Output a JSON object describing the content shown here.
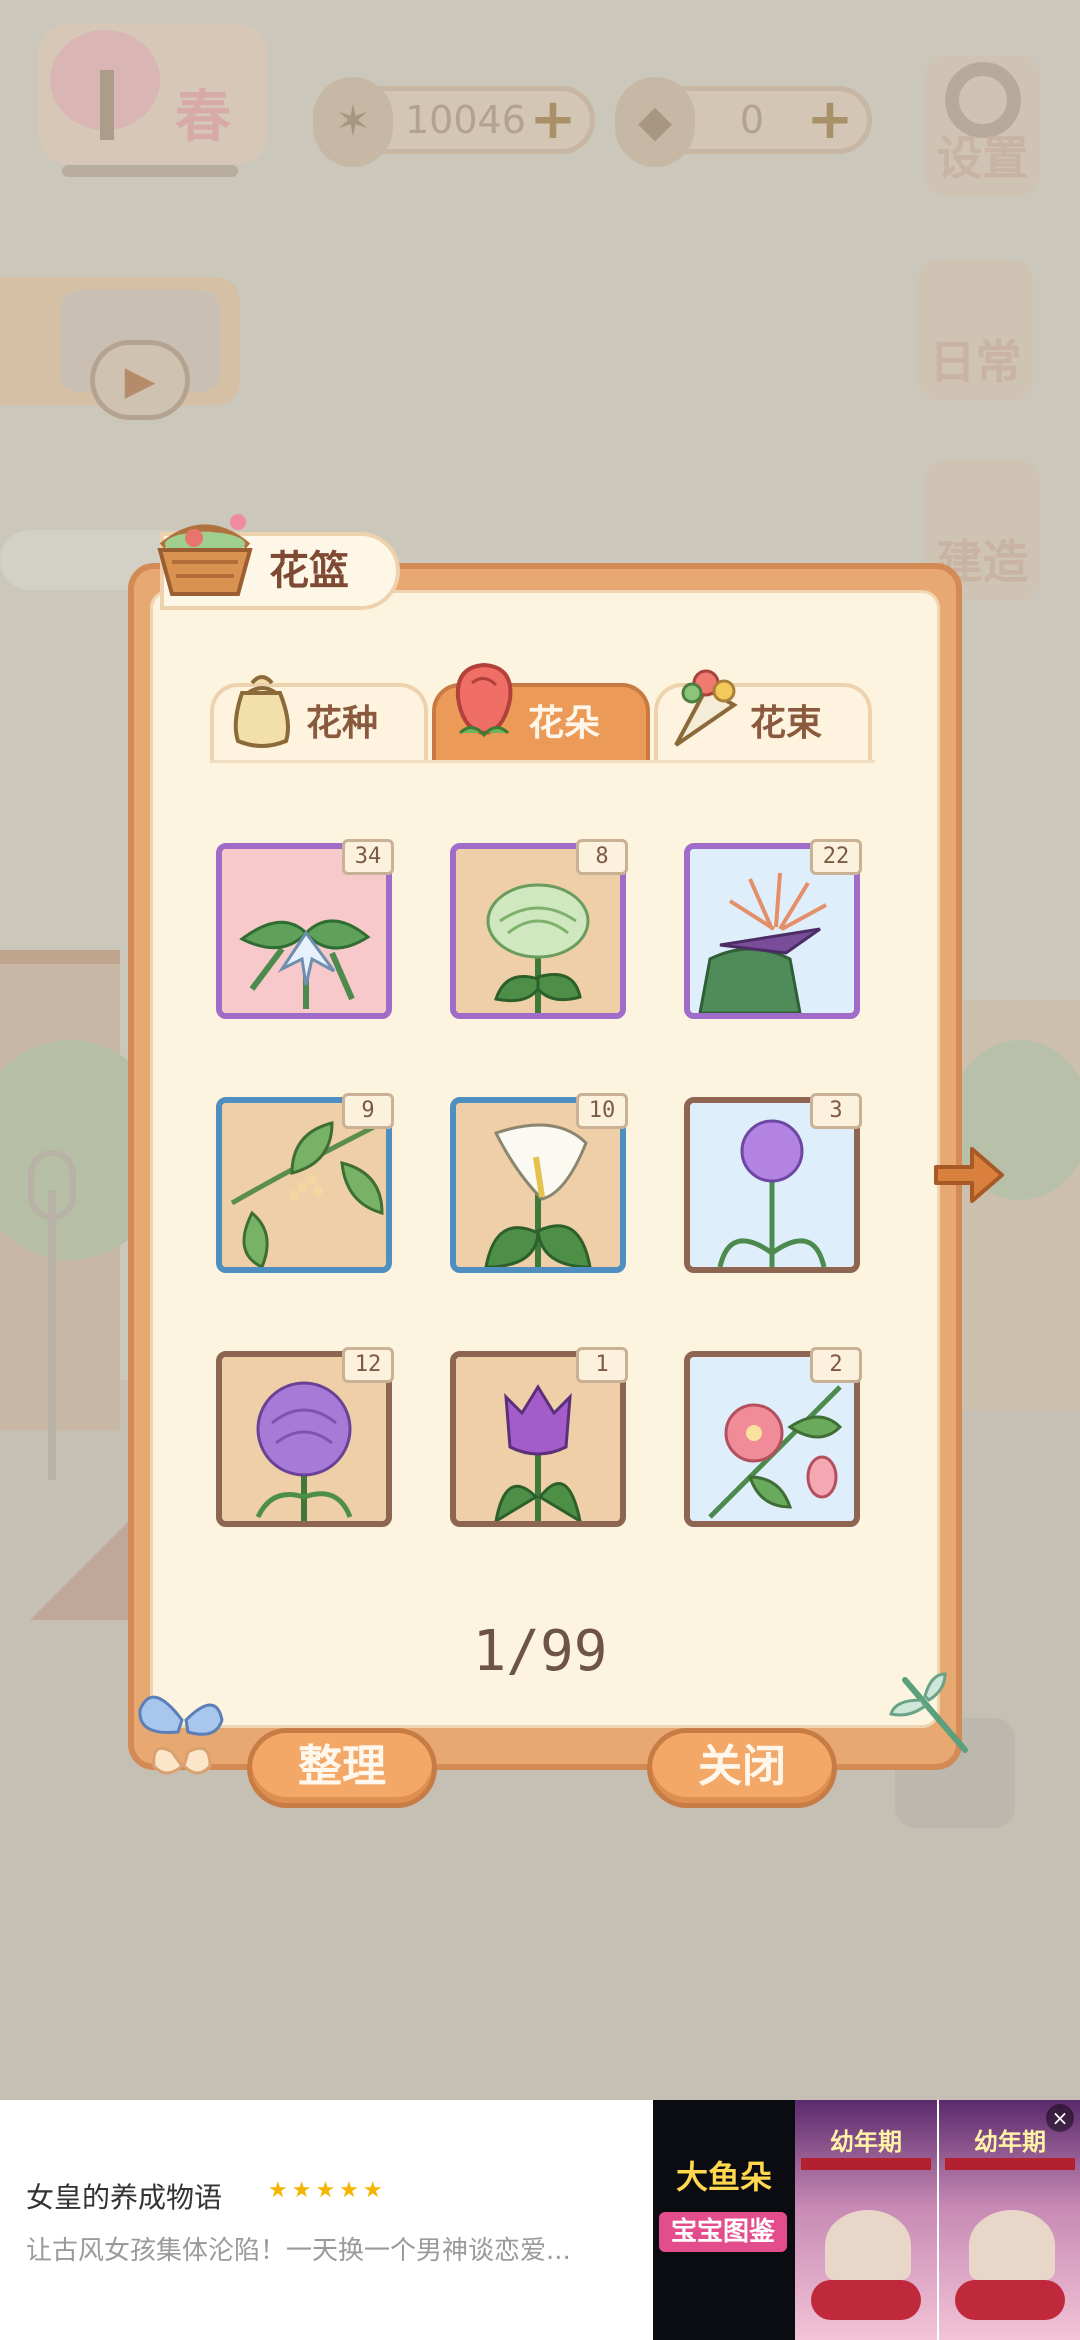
{
  "hud": {
    "season": "春",
    "fish_icon": "fish-bone-icon",
    "fish_count": "10046",
    "cheese_icon": "cheese-icon",
    "cheese_count": "0",
    "plus": "+",
    "settings_label": "设置",
    "daily_label": "日常",
    "build_label": "建造"
  },
  "panel": {
    "title": "花篮",
    "tabs": [
      {
        "label": "花种",
        "icon": "seed-bag-icon",
        "active": false
      },
      {
        "label": "花朵",
        "icon": "rose-icon",
        "active": true
      },
      {
        "label": "花束",
        "icon": "bouquet-icon",
        "active": false
      }
    ],
    "items": [
      {
        "count": "34",
        "rarity": "purple",
        "icon": "white-lily-flower-icon",
        "bg": "#f8c9cb"
      },
      {
        "count": "8",
        "rarity": "purple",
        "icon": "green-chrysanthemum-icon",
        "bg": "#efcfa8"
      },
      {
        "count": "22",
        "rarity": "purple",
        "icon": "bird-of-paradise-icon",
        "bg": "#dfeefb"
      },
      {
        "count": "9",
        "rarity": "blue",
        "icon": "osmanthus-icon",
        "bg": "#efcfa8"
      },
      {
        "count": "10",
        "rarity": "blue",
        "icon": "calla-lily-icon",
        "bg": "#efcfa8"
      },
      {
        "count": "3",
        "rarity": "brown",
        "icon": "allium-icon",
        "bg": "#dfeefb"
      },
      {
        "count": "12",
        "rarity": "brown",
        "icon": "purple-carnation-icon",
        "bg": "#efcfa8"
      },
      {
        "count": "1",
        "rarity": "brown",
        "icon": "purple-tulip-icon",
        "bg": "#efcfa8"
      },
      {
        "count": "2",
        "rarity": "brown",
        "icon": "pink-flower-icon",
        "bg": "#dfeefb"
      }
    ],
    "page": "1/99",
    "sort_label": "整理",
    "close_label": "关闭"
  },
  "ad": {
    "title": "女皇的养成物语",
    "stars": "★★★★★",
    "desc": "让古风女孩集体沦陷！一天换一个男神谈恋爱...",
    "img1_title": "大鱼朵",
    "img1_sub": "宝宝图鉴",
    "img2_title": "幼年期",
    "img3_title": "幼年期",
    "close": "×"
  },
  "colors": {
    "panel_orange": "#e8a872",
    "active_tab": "#ec9a58",
    "rarity_purple": "#a06cc9",
    "rarity_blue": "#4f8fbf",
    "rarity_brown": "#8e6550"
  }
}
